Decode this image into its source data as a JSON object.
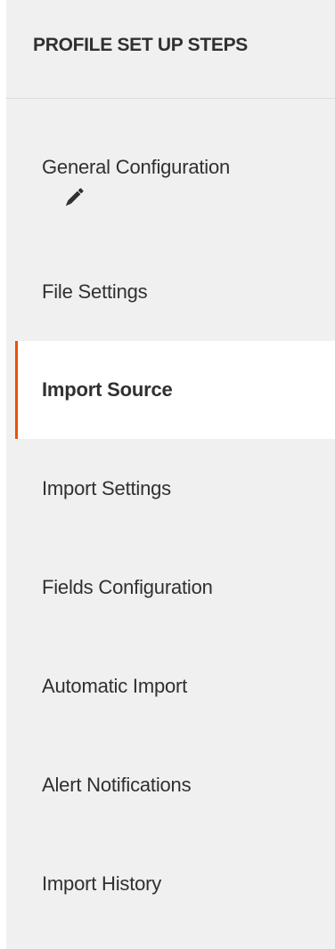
{
  "sidebar": {
    "title": "PROFILE SET UP STEPS",
    "accent_color": "#eb5202",
    "items": [
      {
        "label": "General Configuration",
        "icon": "pencil-icon"
      },
      {
        "label": "File Settings"
      },
      {
        "label": "Import Source",
        "active": true
      },
      {
        "label": "Import Settings"
      },
      {
        "label": "Fields Configuration"
      },
      {
        "label": "Automatic Import"
      },
      {
        "label": "Alert Notifications"
      },
      {
        "label": "Import History"
      }
    ]
  }
}
